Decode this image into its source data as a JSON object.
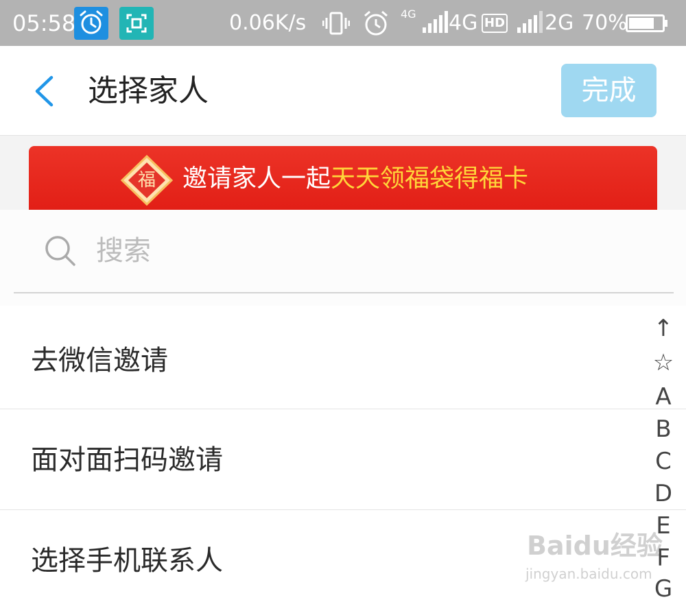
{
  "status_bar": {
    "time": "05:58",
    "net_speed": "0.06K/s",
    "sim1_small": "4G",
    "sim1_network": "4G",
    "hd_badge": "HD",
    "sim2_network": "2G",
    "battery": "70%",
    "icons": [
      "alarm-app-icon",
      "scan-app-icon",
      "vibrate-icon",
      "alarm-clock-icon",
      "signal-icon",
      "signal-icon",
      "battery-icon"
    ]
  },
  "header": {
    "title": "选择家人",
    "done_label": "完成"
  },
  "banner": {
    "logo_text": "福",
    "text_white": "邀请家人一起",
    "text_yellow": "天天领福袋得福卡"
  },
  "search": {
    "placeholder": "搜索"
  },
  "list": [
    {
      "label": "去微信邀请"
    },
    {
      "label": "面对面扫码邀请"
    },
    {
      "label": "选择手机联系人"
    }
  ],
  "index_bar": [
    "↑",
    "☆",
    "A",
    "B",
    "C",
    "D",
    "E",
    "F",
    "G"
  ],
  "watermark": {
    "brand": "Baidu经验",
    "url": "jingyan.baidu.com"
  },
  "colors": {
    "status_bar_bg": "#b3b3b3",
    "accent_blue": "#1e8fe0",
    "done_button_bg": "#9fd8f1",
    "banner_red": "#e21f16",
    "banner_yellow_text": "#ffd63a"
  }
}
